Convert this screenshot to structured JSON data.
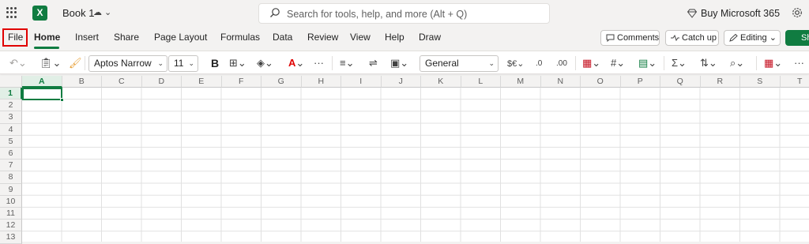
{
  "app": {
    "book_title": "Book 1"
  },
  "search": {
    "placeholder": "Search for tools, help, and more (Alt + Q)"
  },
  "header": {
    "buy_label": "Buy Microsoft 365"
  },
  "tabs": [
    {
      "label": "File"
    },
    {
      "label": "Home"
    },
    {
      "label": "Insert"
    },
    {
      "label": "Share"
    },
    {
      "label": "Page Layout"
    },
    {
      "label": "Formulas"
    },
    {
      "label": "Data"
    },
    {
      "label": "Review"
    },
    {
      "label": "View"
    },
    {
      "label": "Help"
    },
    {
      "label": "Draw"
    }
  ],
  "actions": {
    "comments": "Comments",
    "catchup": "Catch up",
    "editing": "Editing",
    "share": "Sh"
  },
  "ribbon": {
    "font_name": "Aptos Narrow",
    "font_size": "11",
    "bold": "B",
    "number_format": "General"
  },
  "columns": [
    "A",
    "B",
    "C",
    "D",
    "E",
    "F",
    "G",
    "H",
    "I",
    "J",
    "K",
    "L",
    "M",
    "N",
    "O",
    "P",
    "Q",
    "R",
    "S",
    "T"
  ],
  "rows": [
    "1",
    "2",
    "3",
    "4",
    "5",
    "6",
    "7",
    "8",
    "9",
    "10",
    "11",
    "12",
    "13"
  ],
  "colors": {
    "accent": "#107c41",
    "highlight": "#e00000"
  }
}
